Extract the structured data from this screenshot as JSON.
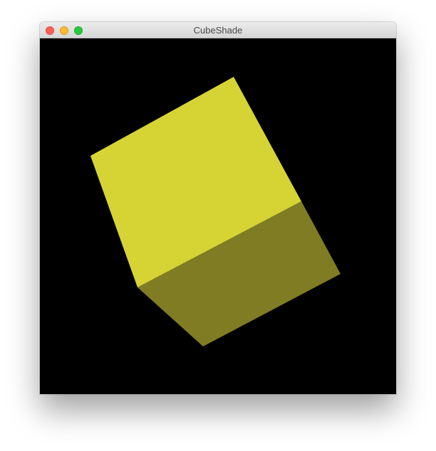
{
  "window": {
    "title": "CubeShade",
    "controls": [
      {
        "name": "close",
        "color": "#ff5f57",
        "border": "#e2463f"
      },
      {
        "name": "minimize",
        "color": "#febc2e",
        "border": "#d89e24"
      },
      {
        "name": "zoom",
        "color": "#28c840",
        "border": "#1aab29"
      }
    ]
  },
  "scene": {
    "background": "#000000",
    "cube": {
      "top_face_color": "#d6d435",
      "side_face_color": "#7f7c24"
    }
  }
}
